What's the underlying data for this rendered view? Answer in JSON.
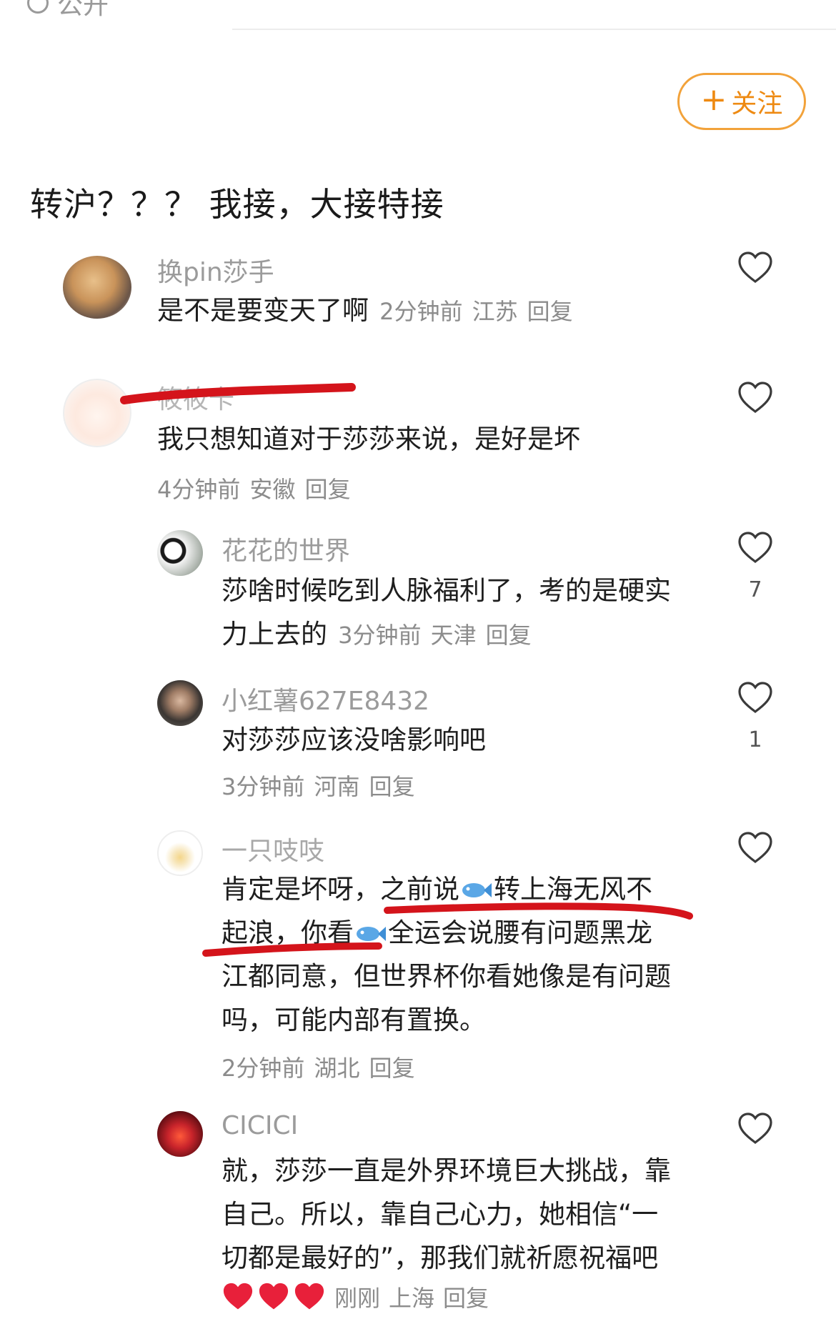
{
  "header": {
    "public_label": "公开",
    "follow_label": "关注",
    "follow_plus": "+"
  },
  "post": {
    "text": "转沪？？？ 我接，大接特接"
  },
  "comments": [
    {
      "user": "换pin莎手",
      "text": "是不是要变天了啊",
      "time": "2分钟前",
      "location": "江苏",
      "reply": "回复",
      "likes": ""
    },
    {
      "user": "筱筱卡",
      "text": "我只想知道对于莎莎来说，是好是坏",
      "time": "4分钟前",
      "location": "安徽",
      "reply": "回复",
      "likes": ""
    }
  ],
  "replies": [
    {
      "user": "花花的世界",
      "text_line1": "莎啥时候吃到人脉福利了，考的是硬实",
      "text_line2": "力上去的",
      "time": "3分钟前",
      "location": "天津",
      "reply": "回复",
      "likes": "7"
    },
    {
      "user": "小红薯627E8432",
      "text": "对莎莎应该没啥影响吧",
      "time": "3分钟前",
      "location": "河南",
      "reply": "回复",
      "likes": "1"
    },
    {
      "user": "一只吱吱",
      "line1_a": "肯定是坏呀，之前说",
      "line1_b": "转上海无风不",
      "line2_a": "起浪，你看",
      "line2_b": "全运会说腰有问题黑龙",
      "line3": "江都同意，但世界杯你看她像是有问题",
      "line4": "吗，可能内部有置换。",
      "time": "2分钟前",
      "location": "湖北",
      "reply": "回复",
      "likes": ""
    },
    {
      "user": "CICICI",
      "line1": "就，莎莎一直是外界环境巨大挑战，靠",
      "line2": "自己。所以，靠自己心力，她相信“一",
      "line3": "切都是最好的”，那我们就祈愿祝福吧",
      "time": "刚刚",
      "location": "上海",
      "reply": "回复",
      "likes": ""
    }
  ],
  "icons": {
    "heart": "heart-outline-icon",
    "fish": "fish-emoji-icon",
    "red_heart": "red-heart-emoji-icon"
  },
  "colors": {
    "follow_accent": "#ee8a12",
    "username": "#9b9b9b",
    "meta": "#8c8c8c",
    "redact_line": "#d4141b",
    "heart_red": "#e8203a"
  }
}
